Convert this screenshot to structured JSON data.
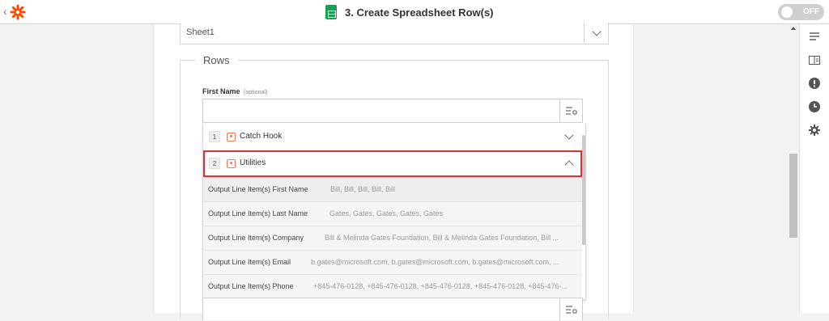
{
  "header": {
    "title": "3. Create Spreadsheet Row(s)",
    "toggle_label": "OFF",
    "brand_color": "#ff4a00"
  },
  "sheet_select": {
    "value": "Sheet1"
  },
  "rows_section": {
    "legend": "Rows",
    "field_label": "First Name",
    "field_optional": "(optional)",
    "input_value": ""
  },
  "steps": [
    {
      "number": "1",
      "label": "Catch Hook",
      "expanded": false,
      "icon": "webhook-icon"
    },
    {
      "number": "2",
      "label": "Utilities",
      "expanded": true,
      "icon": "utilities-icon"
    }
  ],
  "outputs": [
    {
      "label": "Output Line Item(s) First Name",
      "value": "Bill, Bill, Bill, Bill, Bill"
    },
    {
      "label": "Output Line Item(s) Last Name",
      "value": "Gates, Gates, Gates, Gates, Gates"
    },
    {
      "label": "Output Line Item(s) Company",
      "value": "Bill & Melinda Gates Foundation, Bill & Melinda Gates Foundation, Bill ..."
    },
    {
      "label": "Output Line Item(s) Email",
      "value": "b.gates@microsoft.com, b.gates@microsoft.com, b.gates@microsoft.com, ..."
    },
    {
      "label": "Output Line Item(s) Phone",
      "value": "+845-476-0128, +845-476-0128, +845-476-0128, +845-476-0128, +845-476-..."
    }
  ],
  "selection_color": "#d6333d",
  "rail_icons": [
    "details-icon",
    "layout-icon",
    "alert-icon",
    "history-icon",
    "settings-icon"
  ]
}
